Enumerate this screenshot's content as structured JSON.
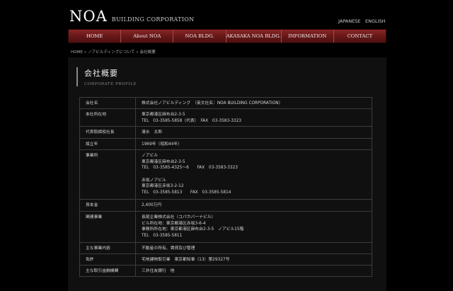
{
  "header": {
    "logo_mark": "NOA",
    "logo_sub": "BUILDING CORPORATION",
    "lang_ja": "JAPANESE",
    "lang_en": "ENGLISH"
  },
  "nav": {
    "items": [
      "HOME",
      "About NOA",
      "NOA BLDG.",
      "AKASAKA NOA BLDG.",
      "INFORMATION",
      "CONTACT"
    ]
  },
  "breadcrumb": "HOME » ノアビルディングについて » 会社概要",
  "section": {
    "title_ja": "会社概要",
    "title_en": "CORPORATE PROFILE"
  },
  "profile": {
    "rows": [
      {
        "label": "会社名",
        "lines": [
          "株式会社ノアビルディング　（英文社名：NOA BUILDING CORPORATION）"
        ]
      },
      {
        "label": "本社所在地",
        "lines": [
          "東京都港区麻布台2-3-5",
          "TEL　03-3585-5858（代表）　FAX　03-3583-3323"
        ]
      },
      {
        "label": "代表取締役社長",
        "lines": [
          "清水　太郎"
        ]
      },
      {
        "label": "設立年",
        "lines": [
          "1969年（昭和44年）"
        ]
      },
      {
        "label": "事業所",
        "lines": [
          "ノアビル",
          "東京都港区麻布台2-3-5",
          "TEL　03-3585-4325〜6　　FAX　03-3583-3323"
        ],
        "lines2": [
          "赤坂ノアビル",
          "東京都港区赤坂3-2-12",
          "TEL　03-3585-5813　　FAX　03-3585-5814"
        ]
      },
      {
        "label": "資本金",
        "lines": [
          "2,400万円"
        ]
      },
      {
        "label": "関連事業",
        "lines": [
          "長尾企業株式会社（コパカバーナビル）",
          "ビル所在地：東京都港区赤坂3-6-4",
          "事務所所在地：東京都港区麻布台2-3-5　ノアビル15階",
          "TEL　03-3585-5811"
        ]
      },
      {
        "label": "主な事業内容",
        "lines": [
          "不動産の所有、賃貸及び管理"
        ]
      },
      {
        "label": "免許",
        "lines": [
          "宅地建物取引業　東京都知事（13）第29327号"
        ]
      },
      {
        "label": "主な取引金融機関",
        "lines": [
          "三井住友銀行　他"
        ]
      }
    ]
  }
}
